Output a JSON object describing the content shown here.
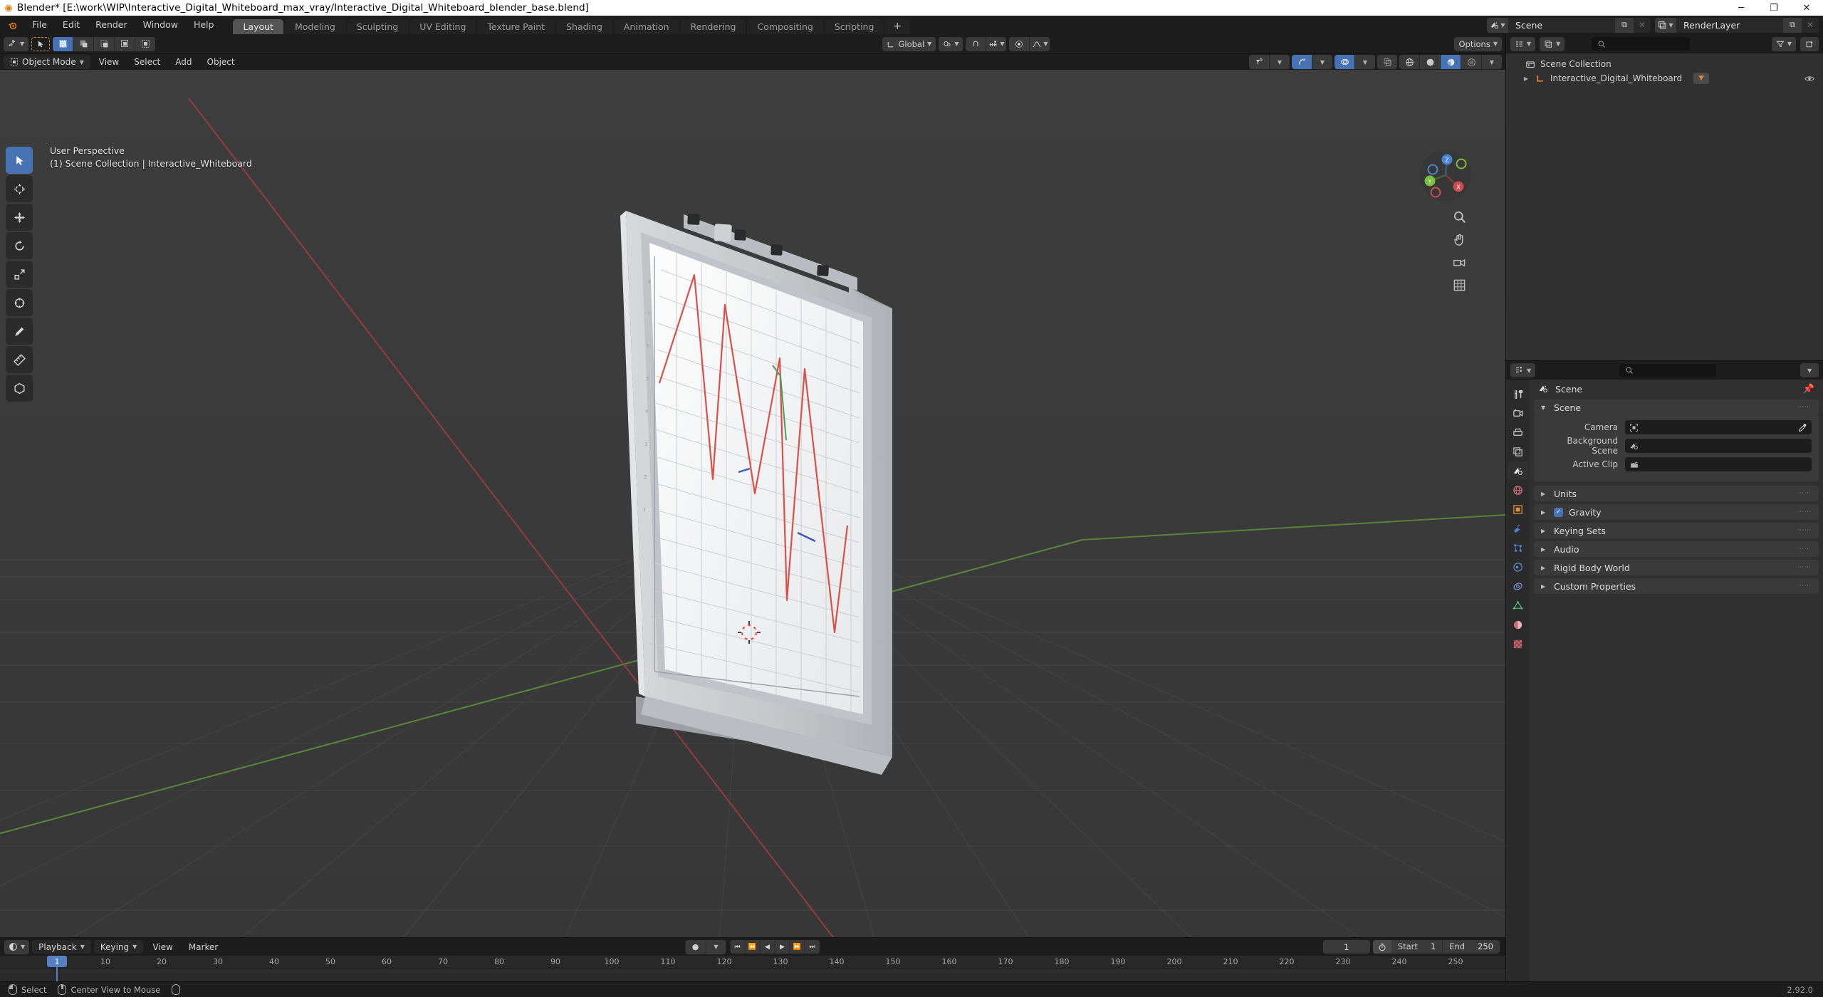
{
  "window": {
    "title": "Blender* [E:\\work\\WIP\\Interactive_Digital_Whiteboard_max_vray/Interactive_Digital_Whiteboard_blender_base.blend]",
    "minimize": "─",
    "maximize": "❐",
    "close": "✕"
  },
  "topbar": {
    "menus": [
      "File",
      "Edit",
      "Render",
      "Window",
      "Help"
    ],
    "tabs": [
      {
        "label": "Layout",
        "active": true
      },
      {
        "label": "Modeling",
        "active": false
      },
      {
        "label": "Sculpting",
        "active": false
      },
      {
        "label": "UV Editing",
        "active": false
      },
      {
        "label": "Texture Paint",
        "active": false
      },
      {
        "label": "Shading",
        "active": false
      },
      {
        "label": "Animation",
        "active": false
      },
      {
        "label": "Rendering",
        "active": false
      },
      {
        "label": "Compositing",
        "active": false
      },
      {
        "label": "Scripting",
        "active": false
      }
    ],
    "add_tab": "+",
    "scene": {
      "name": "Scene",
      "new_btn": "⧉",
      "unlink_btn": "✕"
    },
    "view_layer": {
      "name": "RenderLayer",
      "new_btn": "⧉",
      "unlink_btn": "✕"
    }
  },
  "viewport_header": {
    "editor_type": "editor-type-3dview",
    "cursor_tool": "➤",
    "select_modes": [
      "set",
      "extend",
      "subtract",
      "invert",
      "intersect"
    ],
    "mode": "Object Mode",
    "menus": [
      "View",
      "Select",
      "Add",
      "Object"
    ],
    "transform_orientation": "Global",
    "snap_label": "snap-magnet",
    "proportional_label": "proportional-editing",
    "options": "Options",
    "shading_modes": [
      "wireframe",
      "solid",
      "material-preview",
      "rendered"
    ],
    "active_shading": "material-preview"
  },
  "viewport": {
    "perspective": "User Perspective",
    "scene_info": "(1) Scene Collection | Interactive_Whiteboard",
    "gizmo_axes": [
      "X",
      "Y",
      "Z"
    ],
    "tools": [
      "tweak",
      "cursor",
      "move",
      "rotate",
      "scale",
      "transform",
      "annotate",
      "measure",
      "add-cube"
    ],
    "nav_icons": [
      "zoom",
      "pan",
      "camera",
      "toggle-ortho"
    ]
  },
  "outliner": {
    "display_mode": "View Layer",
    "search_placeholder": "",
    "filter": "filter-icon",
    "new_collection": "new-collection-icon",
    "rows": [
      {
        "label": "Scene Collection",
        "icon": "collection-icon",
        "depth": 0,
        "expandable": false,
        "badge": null,
        "eye": false
      },
      {
        "label": "Interactive_Digital_Whiteboard",
        "icon": "mesh-icon",
        "depth": 1,
        "expandable": true,
        "badge": "modifier",
        "eye": true
      }
    ]
  },
  "properties": {
    "search_placeholder": "",
    "tabs": [
      {
        "name": "tool",
        "icon": "🔧",
        "active": false
      },
      {
        "name": "render",
        "icon": "📷",
        "active": false
      },
      {
        "name": "output",
        "icon": "🖨",
        "active": false
      },
      {
        "name": "view-layer",
        "icon": "🖼",
        "active": false
      },
      {
        "name": "scene",
        "icon": "◑",
        "active": true
      },
      {
        "name": "world",
        "icon": "🌐",
        "active": false
      },
      {
        "name": "object",
        "icon": "▣",
        "active": false
      },
      {
        "name": "modifiers",
        "icon": "🔧",
        "active": false
      },
      {
        "name": "particles",
        "icon": "⁂",
        "active": false
      },
      {
        "name": "physics",
        "icon": "◎",
        "active": false
      },
      {
        "name": "constraints",
        "icon": "⦿",
        "active": false
      },
      {
        "name": "data",
        "icon": "▽",
        "active": false
      },
      {
        "name": "material",
        "icon": "◔",
        "active": false
      },
      {
        "name": "texture",
        "icon": "▦",
        "active": false
      }
    ],
    "breadcrumb": "Scene",
    "panels": [
      {
        "label": "Scene",
        "open": true,
        "checkbox": null
      },
      {
        "label": "Units",
        "open": false,
        "checkbox": null
      },
      {
        "label": "Gravity",
        "open": false,
        "checkbox": true
      },
      {
        "label": "Keying Sets",
        "open": false,
        "checkbox": null
      },
      {
        "label": "Audio",
        "open": false,
        "checkbox": null
      },
      {
        "label": "Rigid Body World",
        "open": false,
        "checkbox": null
      },
      {
        "label": "Custom Properties",
        "open": false,
        "checkbox": null
      }
    ],
    "scene_fields": [
      {
        "label": "Camera",
        "value": "",
        "icon": "camera-icon",
        "eyedropper": true
      },
      {
        "label": "Background Scene",
        "value": "",
        "icon": "scene-icon",
        "eyedropper": false
      },
      {
        "label": "Active Clip",
        "value": "",
        "icon": "clip-icon",
        "eyedropper": false
      }
    ]
  },
  "timeline": {
    "editor_icon": "timeline-icon",
    "menus": [
      "Playback",
      "Keying",
      "View",
      "Marker"
    ],
    "record_icon": "●",
    "transport": [
      "⏮",
      "⏪",
      "◀",
      "▶",
      "⏩",
      "⏭"
    ],
    "current_frame": "1",
    "start_label": "Start",
    "start_value": "1",
    "end_label": "End",
    "end_value": "250",
    "ticks": [
      10,
      20,
      30,
      40,
      50,
      60,
      70,
      80,
      90,
      100,
      110,
      120,
      130,
      140,
      150,
      160,
      170,
      180,
      190,
      200,
      210,
      220,
      230,
      240,
      250
    ],
    "playhead_frame": "1"
  },
  "statusbar": {
    "items": [
      {
        "icon": "mouse-left",
        "label": "Select"
      },
      {
        "icon": "mouse-middle",
        "label": "Center View to Mouse"
      },
      {
        "icon": "mouse-right",
        "label": ""
      }
    ],
    "version": "2.92.0"
  },
  "chart_on_whiteboard": {
    "type": "line",
    "series": [
      {
        "name": "red-series",
        "color": "#d9504a"
      },
      {
        "name": "green-series",
        "color": "#4f9b5a"
      },
      {
        "name": "blue-series",
        "color": "#3a56b8"
      }
    ]
  },
  "colors": {
    "accent": "#4772b3",
    "orange": "#e87d0d",
    "panel_bg": "#303030",
    "header_bg": "#1d1d1d",
    "viewport_bg": "#393939",
    "field_bg": "#1d1d1d"
  }
}
